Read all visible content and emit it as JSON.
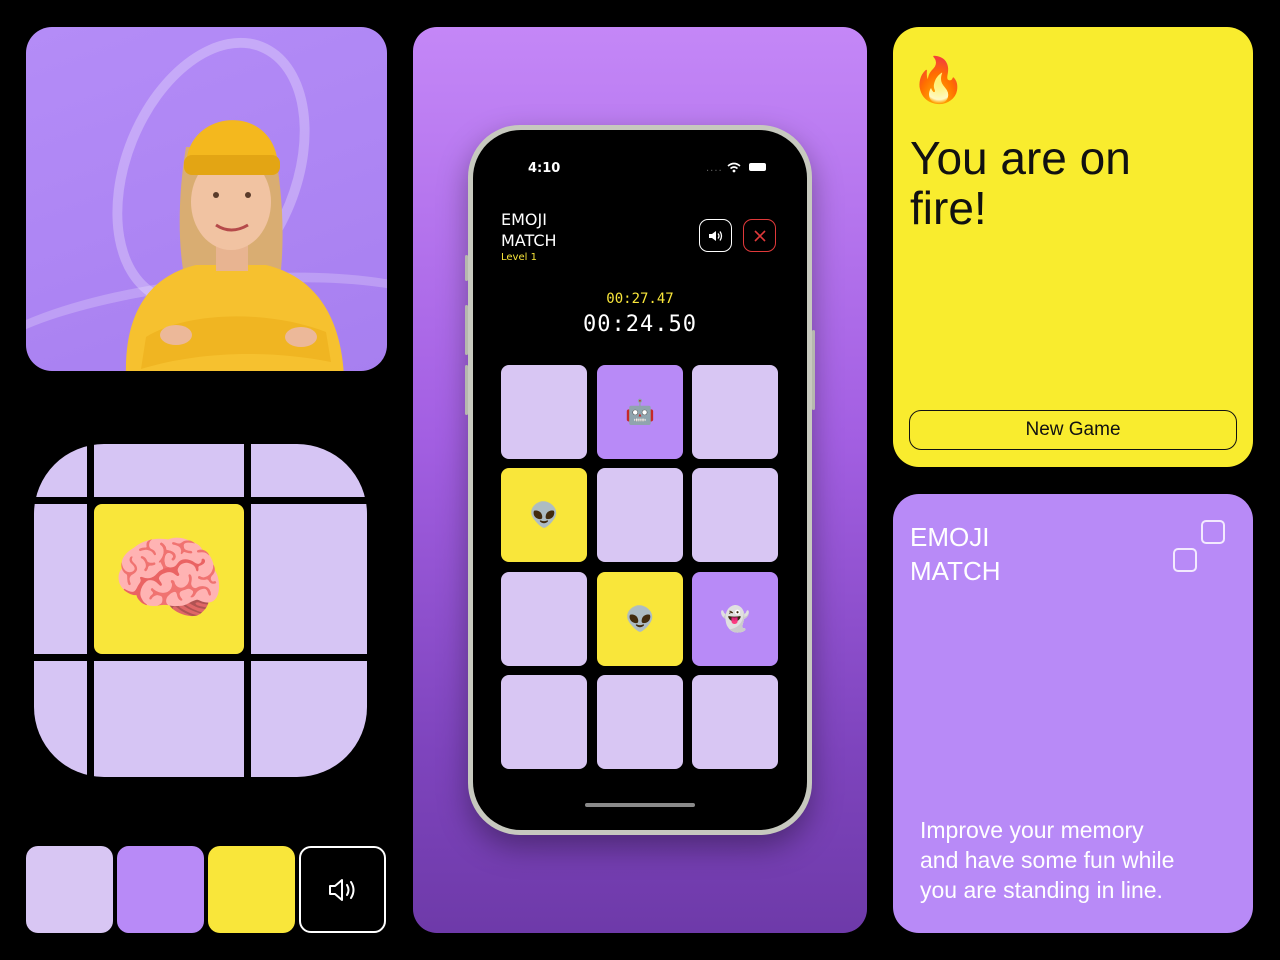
{
  "status_bar": {
    "time": "4:10"
  },
  "game": {
    "title_line1": "EMOJI",
    "title_line2": "MATCH",
    "level": "Level 1",
    "best_time": "00:27.47",
    "current_time": "00:24.50",
    "tiles": [
      {
        "state": "hidden",
        "emoji": ""
      },
      {
        "state": "revealed",
        "emoji": "🤖"
      },
      {
        "state": "hidden",
        "emoji": ""
      },
      {
        "state": "matched",
        "emoji": "👽"
      },
      {
        "state": "hidden",
        "emoji": ""
      },
      {
        "state": "hidden",
        "emoji": ""
      },
      {
        "state": "hidden",
        "emoji": ""
      },
      {
        "state": "matched",
        "emoji": "👽"
      },
      {
        "state": "revealed",
        "emoji": "👻"
      },
      {
        "state": "hidden",
        "emoji": ""
      },
      {
        "state": "hidden",
        "emoji": ""
      },
      {
        "state": "hidden",
        "emoji": ""
      }
    ]
  },
  "fire_card": {
    "emoji": "🔥",
    "headline_line1": "You are on",
    "headline_line2": "fire!",
    "new_game_label": "New Game"
  },
  "info_card": {
    "title_line1": "EMOJI",
    "title_line2": "MATCH",
    "tagline_line1": "Improve your memory",
    "tagline_line2": "and have some fun while",
    "tagline_line3": "you are standing in line."
  },
  "app_icon": {
    "emoji": "🧠"
  },
  "palette": {
    "colors": [
      "#d8c6f3",
      "#b88af7",
      "#f9e63a",
      "#000000"
    ]
  },
  "icons": [
    "speaker-icon",
    "close-icon",
    "wifi-icon",
    "battery-icon",
    "squares-logo-icon",
    "brain-icon",
    "fire-icon"
  ]
}
